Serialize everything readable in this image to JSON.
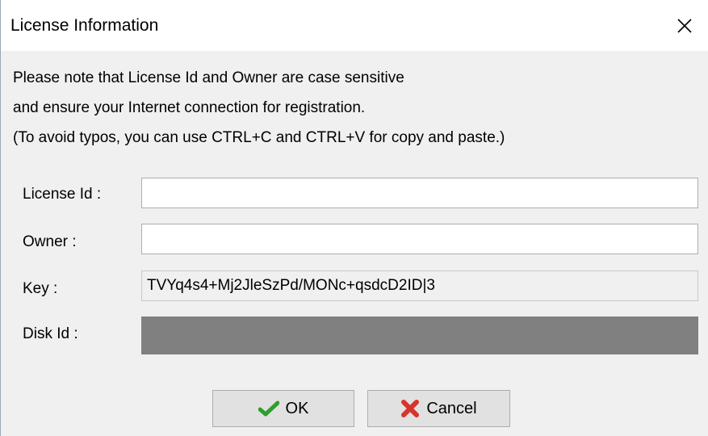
{
  "window": {
    "title": "License Information"
  },
  "notice": {
    "line1": "Please note that License Id and Owner are case sensitive",
    "line2": "and ensure your Internet connection for registration.",
    "line3": "(To avoid typos, you can use CTRL+C and CTRL+V for copy and paste.)"
  },
  "form": {
    "license_id_label": "License Id :",
    "license_id_value": "",
    "owner_label": "Owner :",
    "owner_value": "",
    "key_label": "Key :",
    "key_value": "TVYq4s4+Mj2JleSzPd/MONc+qsdcD2ID|3",
    "disk_id_label": "Disk Id :",
    "disk_id_value": ""
  },
  "buttons": {
    "ok_label": "OK",
    "cancel_label": "Cancel"
  },
  "icons": {
    "close": "close-icon",
    "ok": "checkmark-icon",
    "cancel": "cross-icon"
  },
  "colors": {
    "check_green": "#2e9e2e",
    "cancel_red": "#d9342b",
    "disk_field_gray": "#808080"
  }
}
